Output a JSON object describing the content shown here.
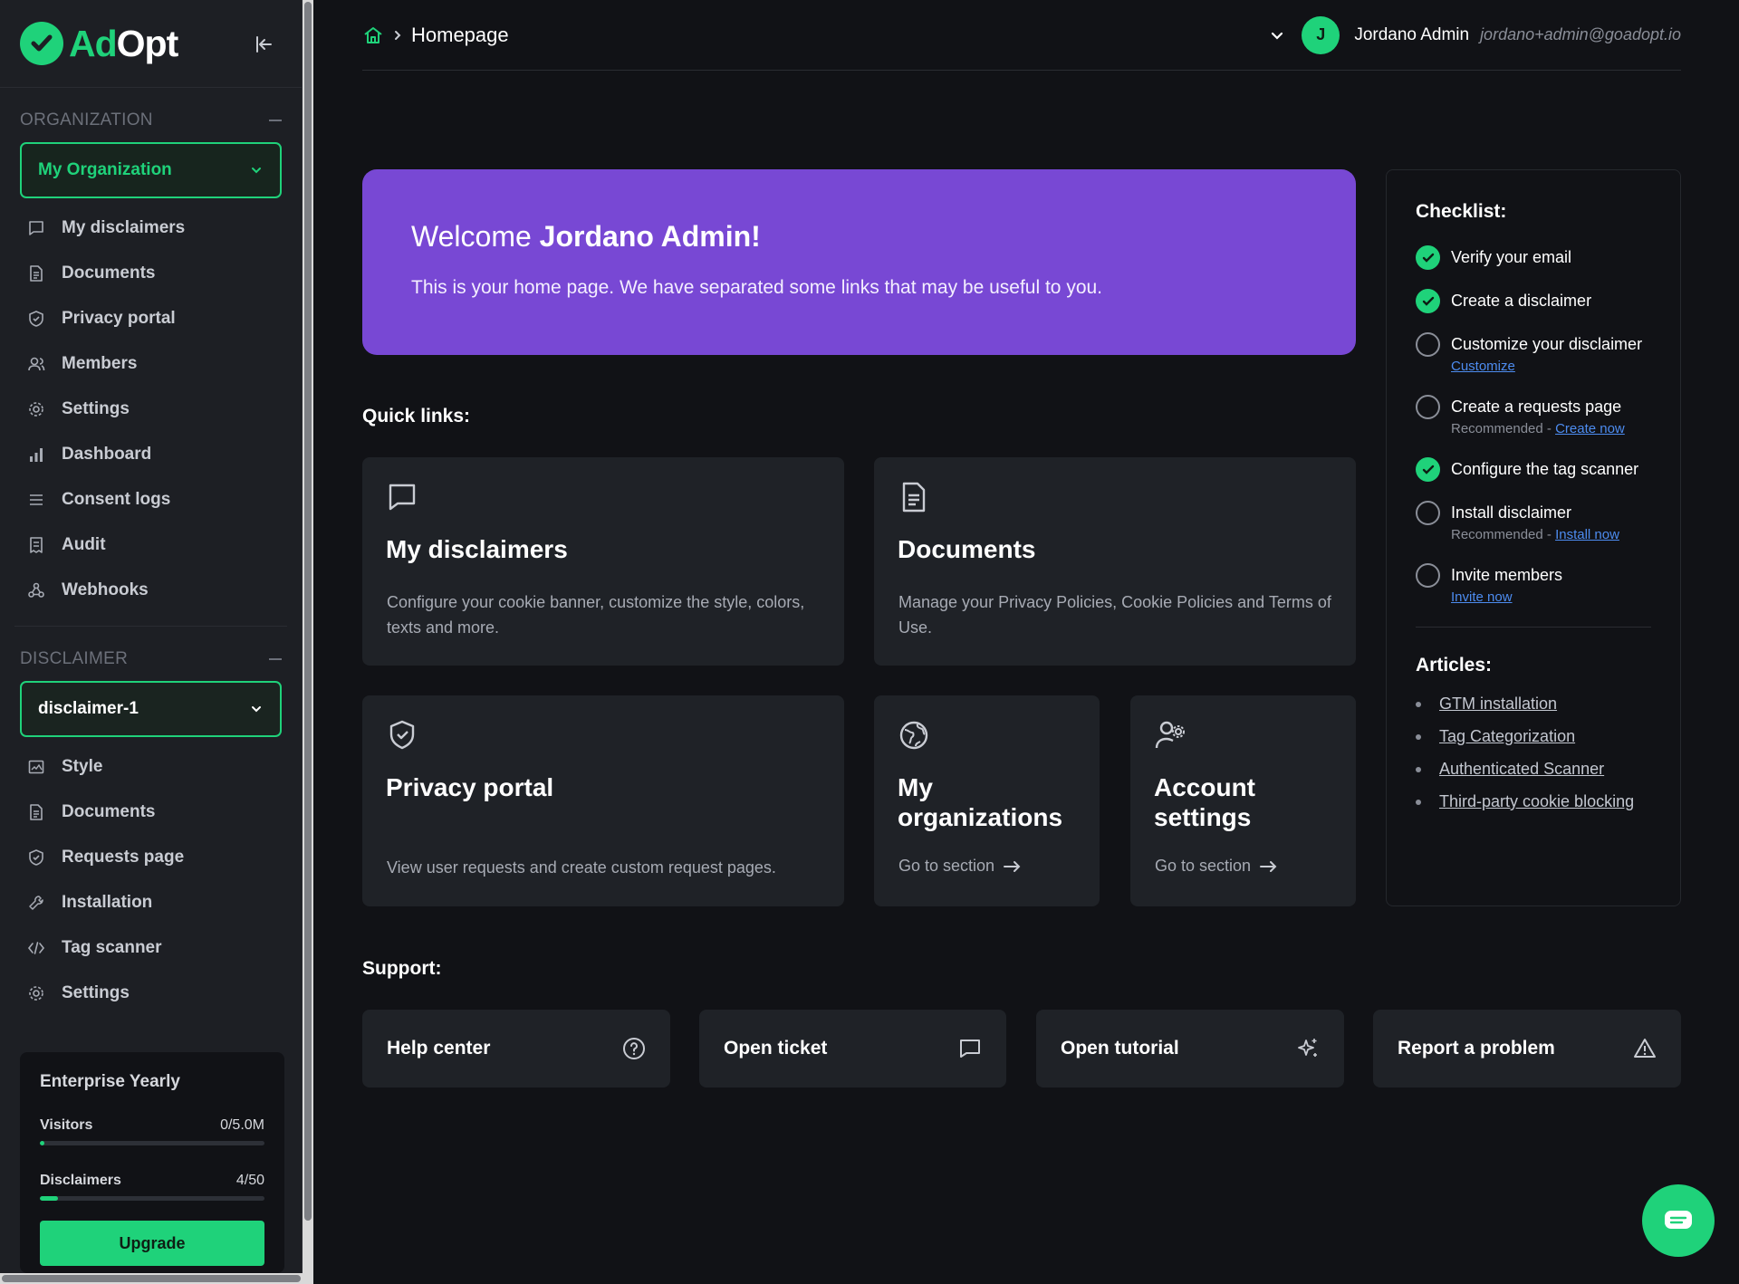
{
  "brand": {
    "name_part1": "Ad",
    "name_part2": "Opt",
    "accent": "#1fd27a",
    "banner": "#7848d4"
  },
  "sidebar": {
    "org_section": "ORGANIZATION",
    "org_selected": "My Organization",
    "org_items": [
      {
        "label": "My disclaimers",
        "icon": "message-square-icon"
      },
      {
        "label": "Documents",
        "icon": "document-icon"
      },
      {
        "label": "Privacy portal",
        "icon": "shield-icon"
      },
      {
        "label": "Members",
        "icon": "users-icon"
      },
      {
        "label": "Settings",
        "icon": "gear-icon"
      },
      {
        "label": "Dashboard",
        "icon": "bar-chart-icon"
      },
      {
        "label": "Consent logs",
        "icon": "list-icon"
      },
      {
        "label": "Audit",
        "icon": "receipt-icon"
      },
      {
        "label": "Webhooks",
        "icon": "webhook-icon"
      }
    ],
    "disc_section": "DISCLAIMER",
    "disc_selected": "disclaimer-1",
    "disc_items": [
      {
        "label": "Style",
        "icon": "image-frame-icon"
      },
      {
        "label": "Documents",
        "icon": "document-icon"
      },
      {
        "label": "Requests page",
        "icon": "shield-icon"
      },
      {
        "label": "Installation",
        "icon": "wrench-icon"
      },
      {
        "label": "Tag scanner",
        "icon": "code-icon"
      },
      {
        "label": "Settings",
        "icon": "gear-icon"
      }
    ],
    "plan": {
      "title": "Enterprise Yearly",
      "visitors_label": "Visitors",
      "visitors_value": "0/5.0M",
      "visitors_fraction": 0.02,
      "disclaimers_label": "Disclaimers",
      "disclaimers_value": "4/50",
      "disclaimers_fraction": 0.08,
      "upgrade_label": "Upgrade"
    }
  },
  "header": {
    "breadcrumb": "Homepage",
    "avatar_initial": "J",
    "user_name": "Jordano Admin",
    "user_email": "jordano+admin@goadopt.io"
  },
  "welcome": {
    "greeting": "Welcome ",
    "name": "Jordano Admin!",
    "text": "This is your home page. We have separated some links that may be useful to you."
  },
  "quick_links": {
    "title": "Quick links:",
    "my_disclaimers": {
      "title": "My disclaimers",
      "desc": "Configure your cookie banner, customize the style, colors, texts and more."
    },
    "documents": {
      "title": "Documents",
      "desc": "Manage your Privacy Policies, Cookie Policies and Terms of Use."
    },
    "privacy_portal": {
      "title": "Privacy portal",
      "desc": "View user requests and create custom request pages."
    },
    "my_organizations": {
      "title": "My organizations",
      "goto": "Go to section"
    },
    "account_settings": {
      "title": "Account settings",
      "goto": "Go to section"
    }
  },
  "checklist": {
    "title": "Checklist:",
    "items": [
      {
        "label": "Verify your email",
        "done": true
      },
      {
        "label": "Create a disclaimer",
        "done": true
      },
      {
        "label": "Customize your disclaimer",
        "done": false,
        "link": "Customize"
      },
      {
        "label": "Create a requests page",
        "done": false,
        "note": "Recommended - ",
        "link": "Create now"
      },
      {
        "label": "Configure the tag scanner",
        "done": true
      },
      {
        "label": "Install disclaimer",
        "done": false,
        "note": "Recommended - ",
        "link": "Install now"
      },
      {
        "label": "Invite members",
        "done": false,
        "link": "Invite now"
      }
    ],
    "articles_title": "Articles:",
    "articles": [
      "GTM installation",
      "Tag Categorization",
      "Authenticated Scanner",
      "Third-party cookie blocking"
    ]
  },
  "support": {
    "title": "Support:",
    "items": [
      {
        "label": "Help center",
        "icon": "help-circle-icon"
      },
      {
        "label": "Open ticket",
        "icon": "message-square-icon"
      },
      {
        "label": "Open tutorial",
        "icon": "sparkles-icon"
      },
      {
        "label": "Report a problem",
        "icon": "warning-triangle-icon"
      }
    ]
  }
}
